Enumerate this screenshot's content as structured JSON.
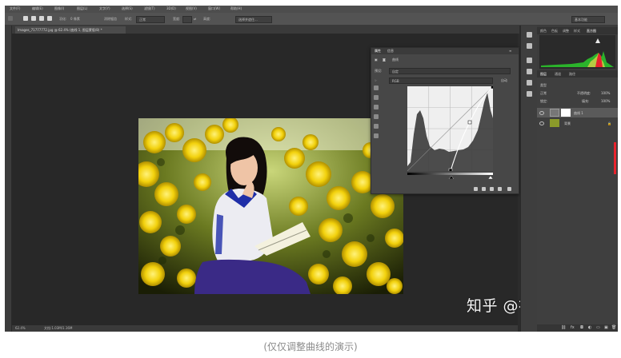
{
  "app": {
    "menu_items": [
      "文件(F)",
      "编辑(E)",
      "图像(I)",
      "图层(L)",
      "文字(Y)",
      "选择(S)",
      "滤镜(T)",
      "3D(D)",
      "视图(V)",
      "窗口(W)",
      "帮助(H)"
    ],
    "options": {
      "feather_label": "羽化:",
      "feather_value": "0 像素",
      "style_label": "样式:",
      "style_value": "正常",
      "width_label": "宽度:",
      "height_label": "高度:",
      "select_mask_label": "选择并遮住..."
    },
    "workspace": "基本功能"
  },
  "document": {
    "tab_title": "Images_71777772.jpg @ 62.4% (曲线 1, 图层蒙版/8) *",
    "status_zoom": "62.4%",
    "status_doc": "文档:1.03M/1.16M"
  },
  "properties": {
    "tabs": [
      "属性",
      "信息"
    ],
    "panel_name": "曲线",
    "preset_label": "预设:",
    "preset_value": "自定",
    "channel_value": "RGB",
    "auto_button": "自动"
  },
  "right_panel": {
    "top_tabs": [
      "颜色",
      "色板",
      "调整",
      "样式",
      "直方图"
    ],
    "layer_tabs": [
      "图层",
      "通道",
      "路径"
    ],
    "filter_kind": "类型",
    "blend_mode": "正常",
    "opacity_label": "不透明度:",
    "opacity_value": "100%",
    "lock_label": "锁定:",
    "fill_label": "填充:",
    "fill_value": "100%",
    "layers": [
      {
        "name": "曲线 1"
      },
      {
        "name": "背景"
      }
    ]
  },
  "watermark": "知乎 @神的孩子",
  "caption": "(仅仅调整曲线的演示)",
  "colors": {
    "accent_red": "#e8232d",
    "panel_bg": "#474747",
    "workspace_bg": "#282828"
  }
}
